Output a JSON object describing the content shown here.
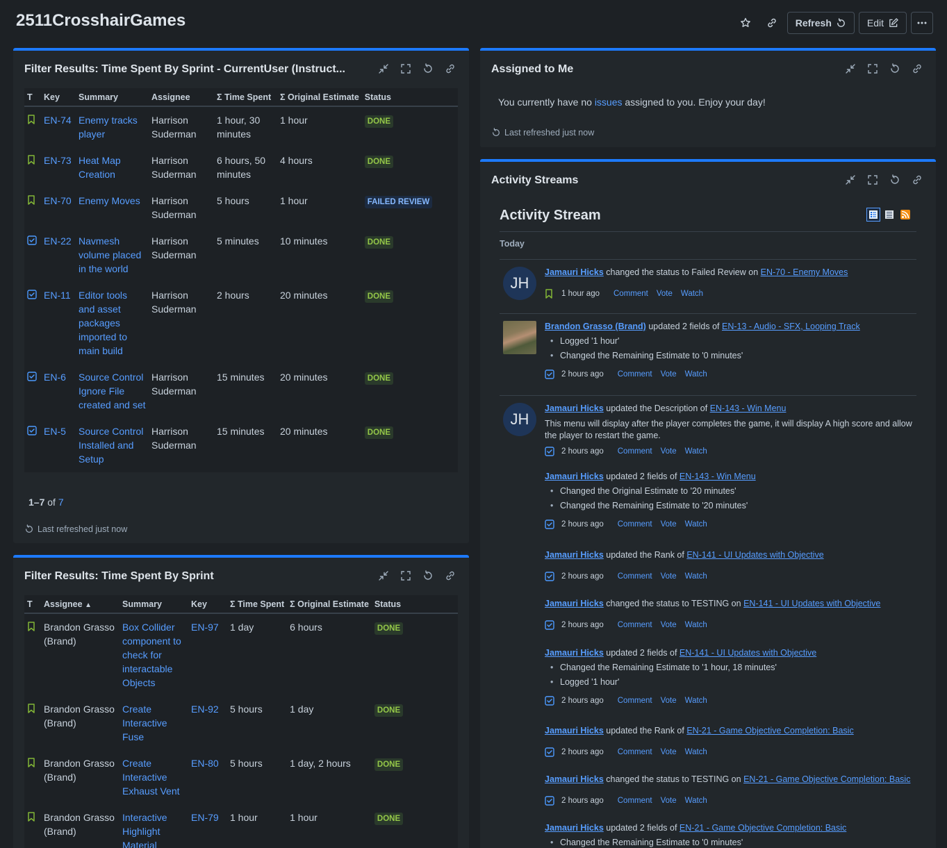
{
  "dashboard": {
    "title": "2511CrosshairGames",
    "refresh_label": "Refresh",
    "edit_label": "Edit"
  },
  "gadget1": {
    "title": "Filter Results: Time Spent By Sprint - CurrentUser (Instruct...",
    "columns": [
      "T",
      "Key",
      "Summary",
      "Assignee",
      "Σ Time Spent",
      "Σ Original Estimate",
      "Status"
    ],
    "rows": [
      {
        "type": "story",
        "key": "EN-74",
        "summary": "Enemy tracks player",
        "assignee": "Harrison Suderman",
        "spent": "1 hour, 30 minutes",
        "estimate": "1 hour",
        "status": "DONE"
      },
      {
        "type": "story",
        "key": "EN-73",
        "summary": "Heat Map Creation",
        "assignee": "Harrison Suderman",
        "spent": "6 hours, 50 minutes",
        "estimate": "4 hours",
        "status": "DONE"
      },
      {
        "type": "story",
        "key": "EN-70",
        "summary": "Enemy Moves",
        "assignee": "Harrison Suderman",
        "spent": "5 hours",
        "estimate": "1 hour",
        "status": "FAILED REVIEW"
      },
      {
        "type": "task",
        "key": "EN-22",
        "summary": "Navmesh volume placed in the world",
        "assignee": "Harrison Suderman",
        "spent": "5 minutes",
        "estimate": "10 minutes",
        "status": "DONE"
      },
      {
        "type": "task",
        "key": "EN-11",
        "summary": "Editor tools and asset packages imported to main build",
        "assignee": "Harrison Suderman",
        "spent": "2 hours",
        "estimate": "20 minutes",
        "status": "DONE"
      },
      {
        "type": "task",
        "key": "EN-6",
        "summary": "Source Control Ignore File created and set",
        "assignee": "Harrison Suderman",
        "spent": "15 minutes",
        "estimate": "20 minutes",
        "status": "DONE"
      },
      {
        "type": "task",
        "key": "EN-5",
        "summary": "Source Control Installed and Setup",
        "assignee": "Harrison Suderman",
        "spent": "15 minutes",
        "estimate": "20 minutes",
        "status": "DONE"
      }
    ],
    "pager_range": "1–7",
    "pager_of": "of",
    "pager_total": "7",
    "refreshed": "Last refreshed just now"
  },
  "gadget2": {
    "title": "Assigned to Me",
    "message_pre": "You currently have no",
    "message_link": "issues",
    "message_post": "assigned to you. Enjoy your day!",
    "refreshed": "Last refreshed just now"
  },
  "gadget3": {
    "title": "Filter Results: Time Spent By Sprint",
    "columns": [
      "T",
      "Assignee",
      "Summary",
      "Key",
      "Σ Time Spent",
      "Σ Original Estimate",
      "Status"
    ],
    "rows": [
      {
        "type": "story",
        "assignee": "Brandon Grasso (Brand)",
        "summary": "Box Collider component to check for interactable Objects",
        "key": "EN-97",
        "spent": "1 day",
        "estimate": "6 hours",
        "status": "DONE"
      },
      {
        "type": "story",
        "assignee": "Brandon Grasso (Brand)",
        "summary": "Create Interactive Fuse",
        "key": "EN-92",
        "spent": "5 hours",
        "estimate": "1 day",
        "status": "DONE"
      },
      {
        "type": "story",
        "assignee": "Brandon Grasso (Brand)",
        "summary": "Create Interactive Exhaust Vent",
        "key": "EN-80",
        "spent": "5 hours",
        "estimate": "1 day, 2 hours",
        "status": "DONE"
      },
      {
        "type": "story",
        "assignee": "Brandon Grasso (Brand)",
        "summary": "Interactive Highlight Material",
        "key": "EN-79",
        "spent": "1 hour",
        "estimate": "1 hour",
        "status": "DONE"
      }
    ]
  },
  "gadget4": {
    "title": "Activity Streams",
    "stream_title": "Activity Stream",
    "today": "Today",
    "actions": {
      "comment": "Comment",
      "vote": "Vote",
      "watch": "Watch"
    },
    "entries": [
      {
        "avatar": "JH",
        "user": "Jamauri Hicks",
        "verb": "changed the status to Failed Review on",
        "issue": "EN-70 - Enemy Moves",
        "bullets": [],
        "desc": "",
        "type": "story",
        "when": "1 hour ago"
      },
      {
        "avatar": "photo",
        "user": "Brandon Grasso (Brand)",
        "verb": "updated 2 fields of",
        "issue": "EN-13 - Audio - SFX, Looping Track",
        "bullets": [
          "Logged '1 hour'",
          "Changed the Remaining Estimate to '0 minutes'"
        ],
        "desc": "",
        "type": "task",
        "when": "2 hours ago"
      },
      {
        "avatar": "JH",
        "user": "Jamauri Hicks",
        "verb": "updated the Description of",
        "issue": "EN-143 - Win Menu",
        "bullets": [],
        "desc": "This menu will display after the player completes the game, it will display A high score and allow the player to restart the game.",
        "type": "task",
        "when": "2 hours ago"
      },
      {
        "avatar": "",
        "user": "Jamauri Hicks",
        "verb": "updated 2 fields of",
        "issue": "EN-143 - Win Menu",
        "bullets": [
          "Changed the Original Estimate to '20 minutes'",
          "Changed the Remaining Estimate to '20 minutes'"
        ],
        "desc": "",
        "type": "task",
        "when": "2 hours ago"
      },
      {
        "avatar": "",
        "user": "Jamauri Hicks",
        "verb": "updated the Rank of",
        "issue": "EN-141 - UI Updates with Objective",
        "bullets": [],
        "desc": "",
        "type": "task",
        "when": "2 hours ago"
      },
      {
        "avatar": "",
        "user": "Jamauri Hicks",
        "verb": "changed the status to TESTING on",
        "issue": "EN-141 - UI Updates with Objective",
        "bullets": [],
        "desc": "",
        "type": "task",
        "when": "2 hours ago"
      },
      {
        "avatar": "",
        "user": "Jamauri Hicks",
        "verb": "updated 2 fields of",
        "issue": "EN-141 - UI Updates with Objective",
        "bullets": [
          "Changed the Remaining Estimate to '1 hour, 18 minutes'",
          "Logged '1 hour'"
        ],
        "desc": "",
        "type": "task",
        "when": "2 hours ago"
      },
      {
        "avatar": "",
        "user": "Jamauri Hicks",
        "verb": "updated the Rank of",
        "issue": "EN-21 - Game Objective Completion: Basic",
        "bullets": [],
        "desc": "",
        "type": "task",
        "when": "2 hours ago"
      },
      {
        "avatar": "",
        "user": "Jamauri Hicks",
        "verb": "changed the status to TESTING on",
        "issue": "EN-21 - Game Objective Completion: Basic",
        "bullets": [],
        "desc": "",
        "type": "task",
        "when": "2 hours ago"
      },
      {
        "avatar": "",
        "user": "Jamauri Hicks",
        "verb": "updated 2 fields of",
        "issue": "EN-21 - Game Objective Completion: Basic",
        "bullets": [
          "Changed the Remaining Estimate to '0 minutes'"
        ],
        "desc": "",
        "type": "task",
        "when": ""
      }
    ]
  },
  "colors": {
    "accent": "#1d7afc",
    "link": "#579dff",
    "done": "#94c748",
    "story": "#82b536",
    "task": "#4c9aff"
  }
}
